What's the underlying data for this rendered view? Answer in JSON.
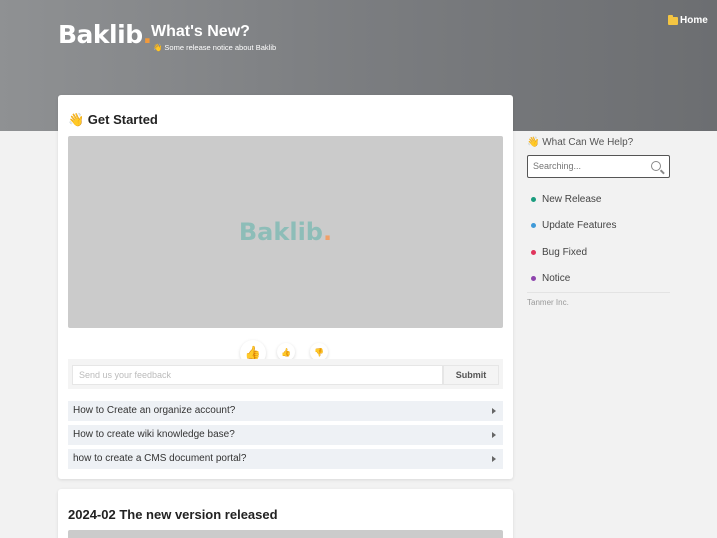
{
  "header": {
    "logo_text": "Baklib",
    "logo_dot": ".",
    "title": "What's New?",
    "subtitle": "👋 Some release notice about Baklib",
    "home_label": "Home",
    "home_icon": "folder-icon"
  },
  "get_started": {
    "title": "👋 Get Started",
    "video_logo": "Baklib",
    "video_logo_dot": ".",
    "reactions": [
      "👍",
      "👍",
      "👎"
    ],
    "feedback_placeholder": "Send us your feedback",
    "submit_label": "Submit",
    "faqs": [
      "How to Create an organize account?",
      "How to create wiki knowledge base?",
      "how to create a CMS document portal?"
    ]
  },
  "release": {
    "title": "2024-02 The new version released"
  },
  "sidebar": {
    "title": "👋 What Can We Help?",
    "search_placeholder": "Searching...",
    "items": [
      {
        "label": "New Release",
        "color": "#1a9c7e"
      },
      {
        "label": "Update Features",
        "color": "#3f9ad8"
      },
      {
        "label": "Bug Fixed",
        "color": "#e0345c"
      },
      {
        "label": "Notice",
        "color": "#8e44ad"
      }
    ],
    "footer": "Tanmer Inc."
  },
  "colors": {
    "accent": "#f29a3c"
  }
}
